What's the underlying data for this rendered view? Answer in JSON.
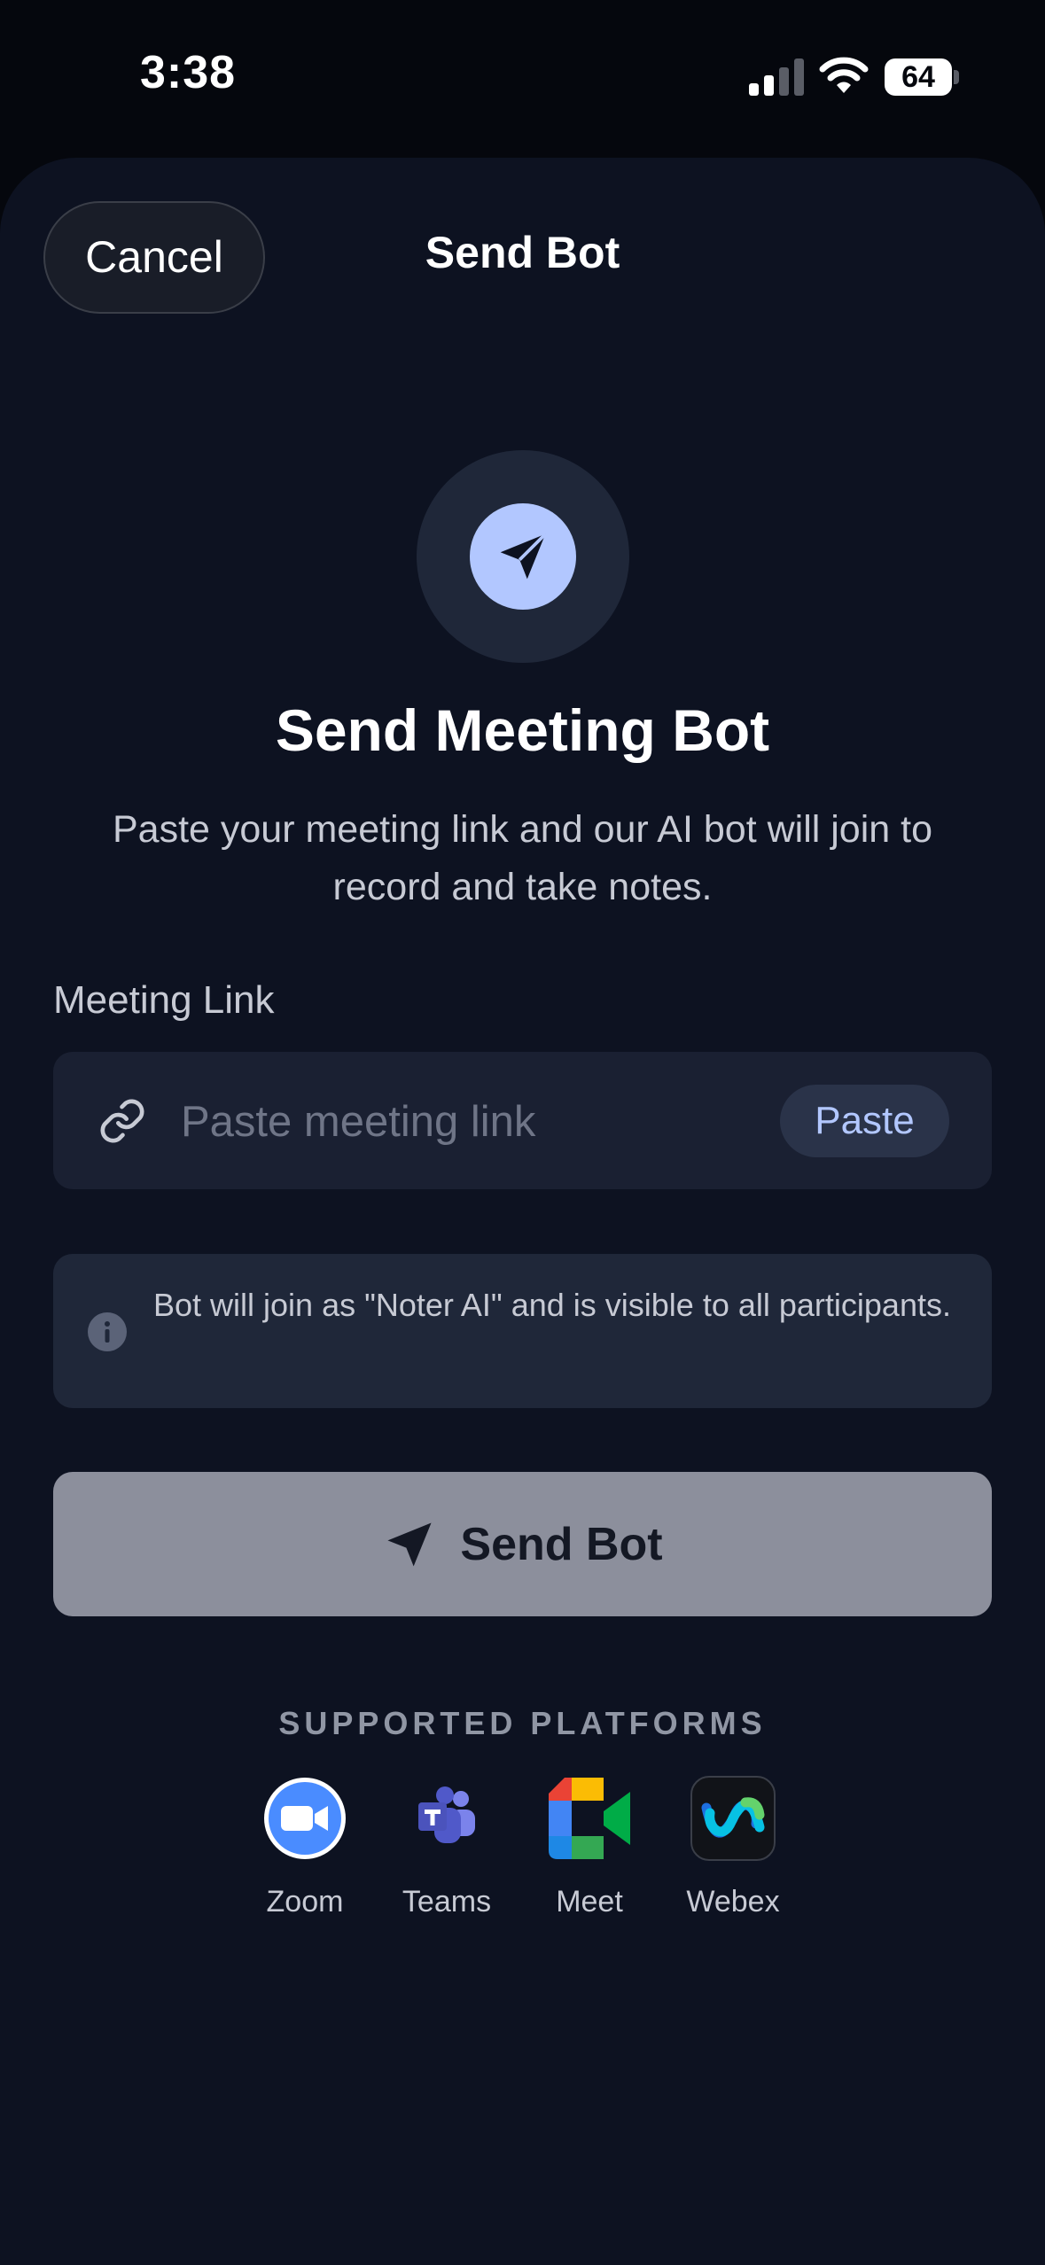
{
  "status_bar": {
    "time": "3:38",
    "battery_percent": "64"
  },
  "nav": {
    "cancel_label": "Cancel",
    "title": "Send Bot"
  },
  "hero": {
    "icon": "paper-plane-icon",
    "heading": "Send Meeting Bot",
    "subtitle": "Paste your meeting link and our AI bot will join to record and take notes."
  },
  "form": {
    "label": "Meeting Link",
    "placeholder": "Paste meeting link",
    "value": "",
    "paste_label": "Paste"
  },
  "info": {
    "icon": "info-icon",
    "text": "Bot will join as \"Noter AI\" and is visible to all participants."
  },
  "send_button": {
    "label": "Send Bot",
    "enabled": false
  },
  "platforms": {
    "title": "SUPPORTED PLATFORMS",
    "items": [
      {
        "name": "Zoom",
        "icon": "zoom-logo-icon"
      },
      {
        "name": "Teams",
        "icon": "teams-logo-icon"
      },
      {
        "name": "Meet",
        "icon": "meet-logo-icon"
      },
      {
        "name": "Webex",
        "icon": "webex-logo-icon"
      }
    ]
  },
  "colors": {
    "background": "#0d1221",
    "accent": "#b2c7ff",
    "surface": "#1a2032",
    "disabled_button": "#8c8f9c"
  }
}
